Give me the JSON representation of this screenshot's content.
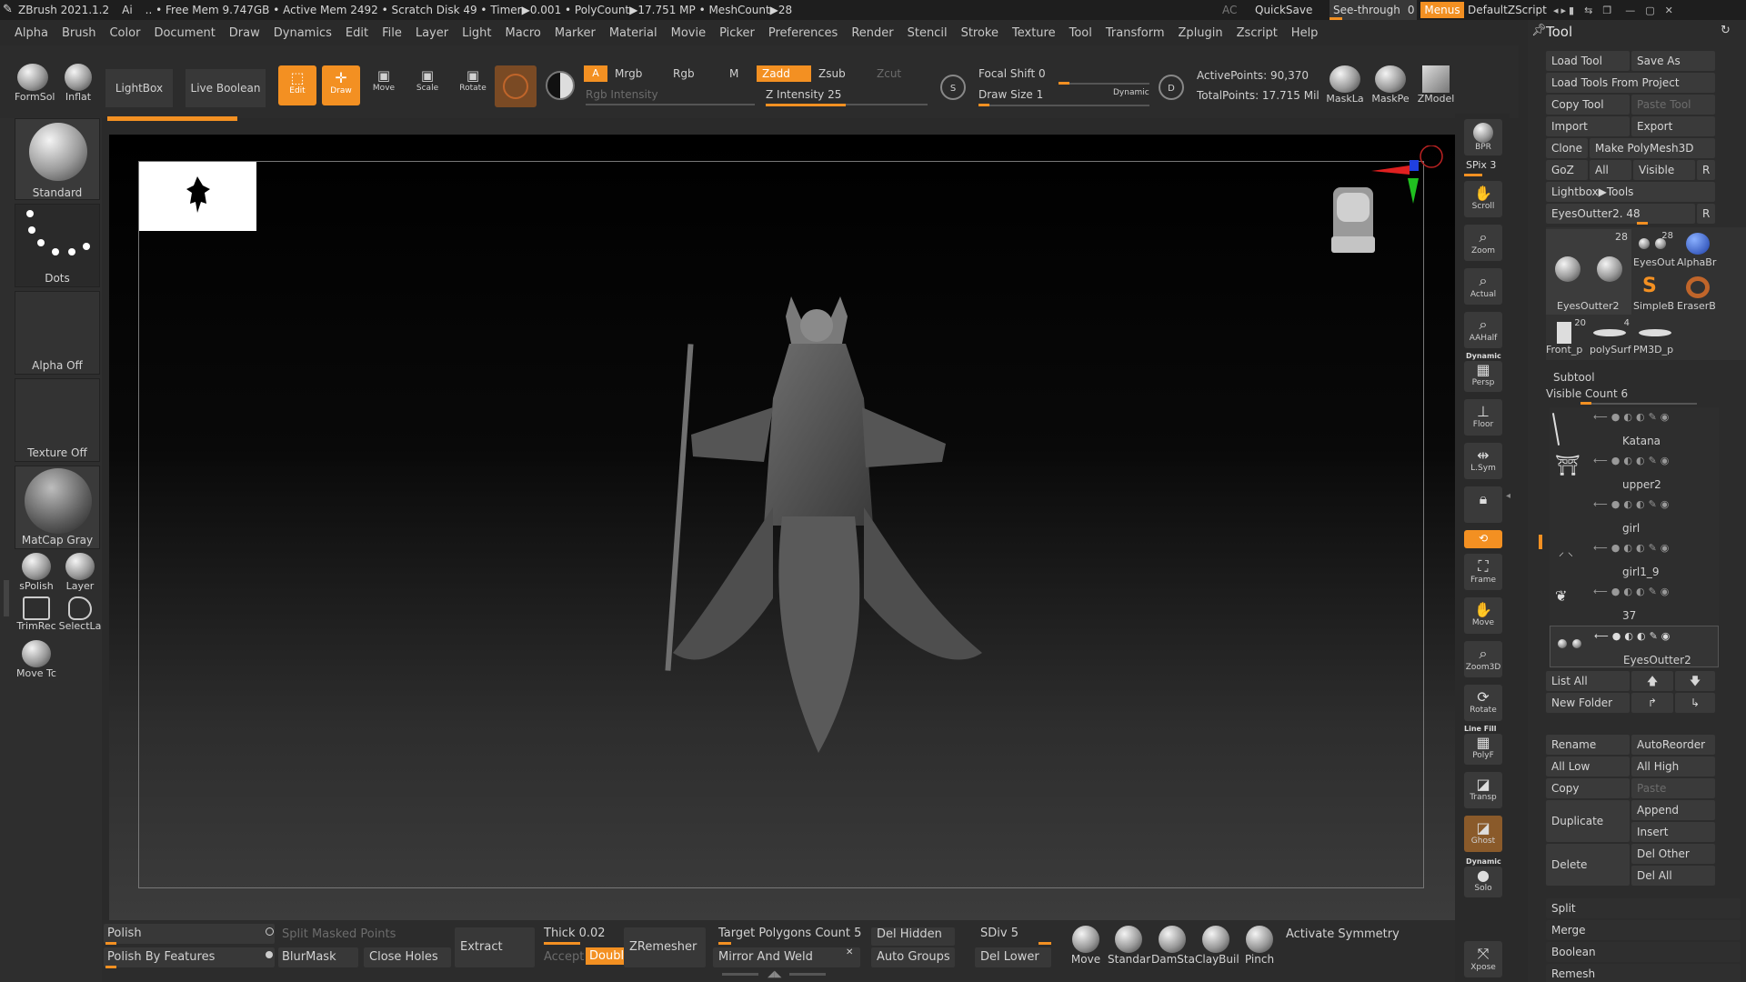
{
  "title": {
    "app": "ZBrush 2021.1.2",
    "ai": "Ai",
    "stats": ".. • Free Mem 9.747GB • Active Mem 2492 • Scratch Disk 49 • Timer▶0.001 • PolyCount▶17.751 MP • MeshCount▶28",
    "ac": "AC",
    "quicksave": "QuickSave",
    "seethrough": "See-through",
    "seethrough_val": "0",
    "menus": "Menus",
    "script": "DefaultZScript"
  },
  "menu": [
    "Alpha",
    "Brush",
    "Color",
    "Document",
    "Draw",
    "Dynamics",
    "Edit",
    "File",
    "Layer",
    "Light",
    "Macro",
    "Marker",
    "Material",
    "Movie",
    "Picker",
    "Preferences",
    "Render",
    "Stencil",
    "Stroke",
    "Texture",
    "Tool",
    "Transform",
    "Zplugin",
    "Zscript",
    "Help"
  ],
  "shelf": {
    "formsoft": "FormSol",
    "inflat": "Inflat",
    "lightbox": "LightBox",
    "live_boolean": "Live Boolean",
    "edit": "Edit",
    "draw": "Draw",
    "move": "Move",
    "scale": "Scale",
    "rotate": "Rotate",
    "a": "A",
    "mrgb": "Mrgb",
    "rgb": "Rgb",
    "m": "M",
    "rgb_intensity": "Rgb Intensity",
    "zadd": "Zadd",
    "zsub": "Zsub",
    "zcut": "Zcut",
    "z_intensity": "Z Intensity 25",
    "focal_shift": "Focal Shift 0",
    "draw_size": "Draw Size 1",
    "dynamic": "Dynamic",
    "active_points": "ActivePoints: 90,370",
    "total_points": "TotalPoints: 17.715 Mil",
    "maskla": "MaskLa",
    "maskpe": "MaskPe",
    "zmodel": "ZModel",
    "s_label": "S",
    "d_label": "D"
  },
  "left": {
    "standard": "Standard",
    "dots": "Dots",
    "alpha_off": "Alpha Off",
    "texture_off": "Texture Off",
    "matcap": "MatCap Gray",
    "spolish": "sPolish",
    "layer": "Layer",
    "trimrec": "TrimRec",
    "selectla": "SelectLa",
    "movetc": "Move Tc"
  },
  "rshelf": [
    "BPR",
    "SPix 3",
    "Scroll",
    "Zoom",
    "Actual",
    "AAHalf",
    "Persp",
    "Floor",
    "L.Sym",
    "",
    "",
    "Frame",
    "Move",
    "Zoom3D",
    "Rotate",
    "PolyF",
    "Transp",
    "Ghost",
    "Solo",
    "Xpose"
  ],
  "rshelf_extra": {
    "dynamic": "Dynamic",
    "linefill": "Line Fill",
    "dynamic2": "Dynamic"
  },
  "tool": {
    "header": "Tool",
    "load_tool": "Load Tool",
    "save_as": "Save As",
    "load_from_project": "Load Tools From Project",
    "copy_tool": "Copy Tool",
    "paste_tool": "Paste Tool",
    "import": "Import",
    "export": "Export",
    "clone": "Clone",
    "make_polymesh": "Make PolyMesh3D",
    "goz": "GoZ",
    "all": "All",
    "visible": "Visible",
    "r": "R",
    "lightbox_tools": "Lightbox▶Tools",
    "eyes_slider": "EyesOutter2. 48",
    "r2": "R",
    "thumbs": [
      {
        "label": "EyesOutter2",
        "count": "28"
      },
      {
        "label": "EyesOut",
        "count": "28"
      },
      {
        "label": "AlphaBr",
        "count": ""
      },
      {
        "label": "SimpleB",
        "count": ""
      },
      {
        "label": "EraserB",
        "count": ""
      },
      {
        "label": "Front_p",
        "count": "20"
      },
      {
        "label": "polySurf",
        "count": "4"
      },
      {
        "label": "PM3D_p",
        "count": ""
      }
    ],
    "subtool": "Subtool",
    "visible_count": "Visible Count 6",
    "subtools": [
      "Katana",
      "upper2",
      "girl",
      "girl1_9",
      "37",
      "EyesOutter2"
    ],
    "list_all": "List All",
    "new_folder": "New Folder",
    "rename": "Rename",
    "autoreorder": "AutoReorder",
    "all_low": "All Low",
    "all_high": "All High",
    "copy": "Copy",
    "paste": "Paste",
    "duplicate": "Duplicate",
    "append": "Append",
    "insert": "Insert",
    "delete": "Delete",
    "del_other": "Del Other",
    "del_all": "Del All",
    "split": "Split",
    "merge": "Merge",
    "boolean": "Boolean",
    "remesh": "Remesh"
  },
  "bottom": {
    "polish": "Polish",
    "polish_features": "Polish By Features",
    "split_masked": "Split Masked Points",
    "blurmask": "BlurMask",
    "close_holes": "Close Holes",
    "extract": "Extract",
    "thick": "Thick 0.02",
    "accept": "Accept",
    "double": "Double",
    "zremesher": "ZRemesher",
    "target_poly": "Target Polygons Count 5",
    "mirror_weld": "Mirror And Weld",
    "del_hidden": "Del Hidden",
    "auto_groups": "Auto Groups",
    "sdiv": "SDiv 5",
    "del_lower": "Del Lower",
    "brushes": [
      "Move",
      "Standar",
      "DamSta",
      "ClayBuil",
      "Pinch"
    ],
    "activate_symmetry": "Activate Symmetry"
  },
  "colors": {
    "accent": "#f39022",
    "panel": "#2c2c2c",
    "button": "#3a3a3a"
  }
}
